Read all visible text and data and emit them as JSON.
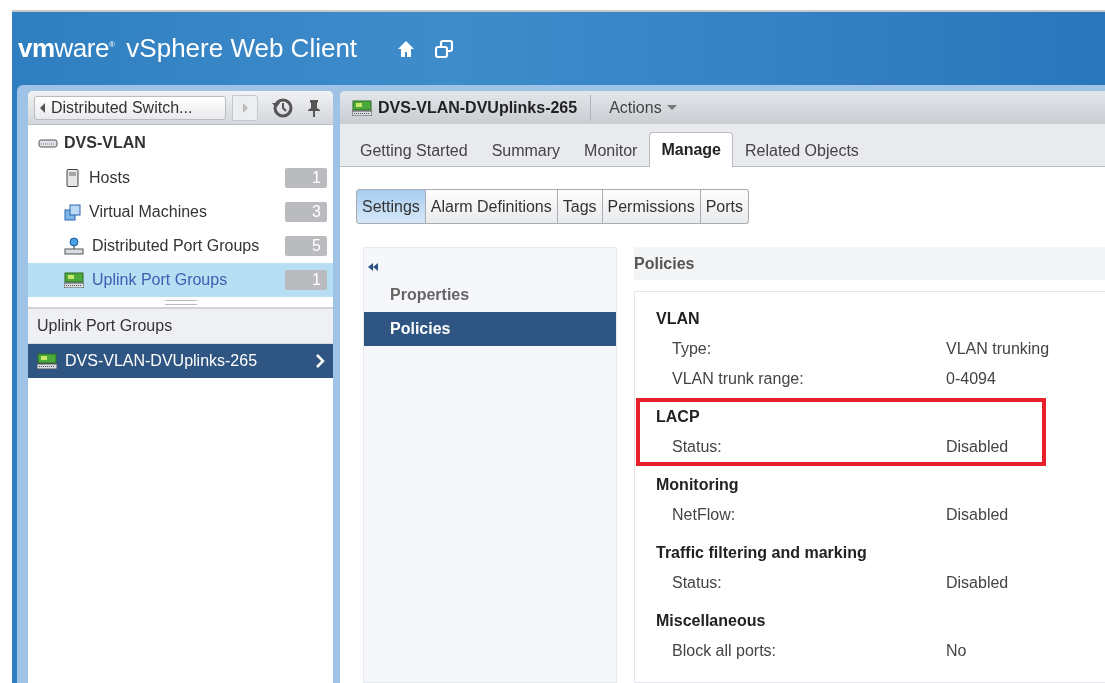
{
  "app": {
    "logo": "**vm**ware$^{®}$",
    "title": "vSphere Web Client"
  },
  "navigator": {
    "breadcrumb": "Distributed Switch...",
    "root": "DVS-VLAN",
    "items": [
      {
        "label": "Hosts",
        "count": "1",
        "kind": "host",
        "selected": false
      },
      {
        "label": "Virtual Machines",
        "count": "3",
        "kind": "vm",
        "selected": false
      },
      {
        "label": "Distributed Port Groups",
        "count": "5",
        "kind": "portgroup",
        "selected": false
      },
      {
        "label": "Uplink Port Groups",
        "count": "1",
        "kind": "uplink",
        "selected": true
      }
    ],
    "list_header": "Uplink Port Groups",
    "list_items": [
      {
        "label": "DVS-VLAN-DVUplinks-265",
        "selected": true
      }
    ]
  },
  "object": {
    "title": "DVS-VLAN-DVUplinks-265",
    "actions": "Actions",
    "tabs": [
      {
        "label": "Getting Started",
        "selected": false
      },
      {
        "label": "Summary",
        "selected": false
      },
      {
        "label": "Monitor",
        "selected": false
      },
      {
        "label": "Manage",
        "selected": true
      },
      {
        "label": "Related Objects",
        "selected": false
      }
    ],
    "subtabs": [
      {
        "label": "Settings",
        "selected": true
      },
      {
        "label": "Alarm Definitions",
        "selected": false
      },
      {
        "label": "Tags",
        "selected": false
      },
      {
        "label": "Permissions",
        "selected": false
      },
      {
        "label": "Ports",
        "selected": false
      }
    ],
    "side_items": [
      {
        "label": "Properties",
        "selected": false
      },
      {
        "label": "Policies",
        "selected": true
      }
    ],
    "panel_title": "Policies",
    "sections": [
      {
        "title": "VLAN",
        "highlighted": false,
        "rows": [
          {
            "label": "Type:",
            "value": "VLAN trunking"
          },
          {
            "label": "VLAN trunk range:",
            "value": "0-4094"
          }
        ]
      },
      {
        "title": "LACP",
        "highlighted": true,
        "rows": [
          {
            "label": "Status:",
            "value": "Disabled"
          }
        ]
      },
      {
        "title": "Monitoring",
        "highlighted": false,
        "rows": [
          {
            "label": "NetFlow:",
            "value": "Disabled"
          }
        ]
      },
      {
        "title": "Traffic filtering and marking",
        "highlighted": false,
        "rows": [
          {
            "label": "Status:",
            "value": "Disabled"
          }
        ]
      },
      {
        "title": "Miscellaneous",
        "highlighted": false,
        "rows": [
          {
            "label": "Block all ports:",
            "value": "No"
          }
        ]
      }
    ]
  }
}
